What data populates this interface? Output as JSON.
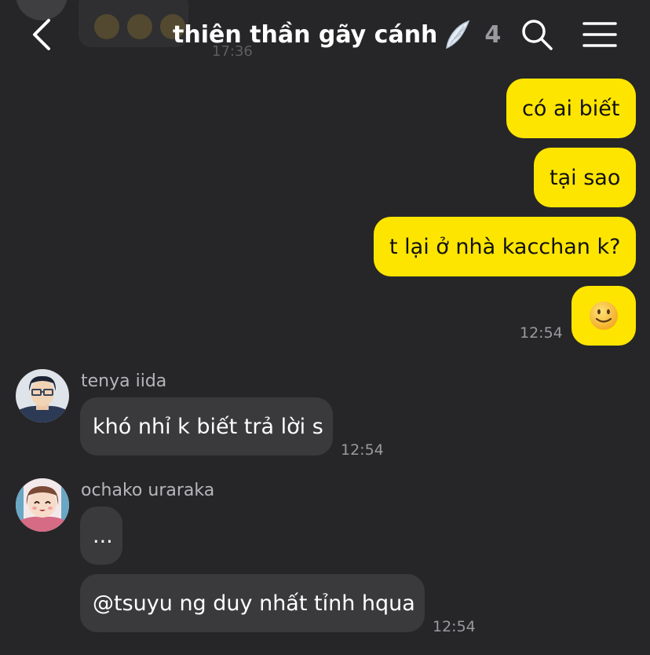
{
  "previous_message": {
    "time": "17:36"
  },
  "header": {
    "title": "thiên thần gãy cánh",
    "title_emoji": "wing-icon",
    "member_count": "4"
  },
  "messages": {
    "m1": "có ai biết",
    "m2": "tại sao",
    "m3": "t lại ở nhà kacchan k?",
    "m4_emoji": "🙂",
    "m4_time": "12:54",
    "iida": {
      "name": "tenya iida",
      "text": "khó nhỉ k biết trả lời s",
      "time": "12:54"
    },
    "ochako": {
      "name": "ochako uraraka",
      "text1": "...",
      "text2": "@tsuyu ng duy nhất tỉnh hqua",
      "time": "12:54"
    }
  },
  "colors": {
    "background": "#262628",
    "my_bubble": "#fee500",
    "their_bubble": "#3a3a3c",
    "timestamp": "#9a9a9e"
  }
}
